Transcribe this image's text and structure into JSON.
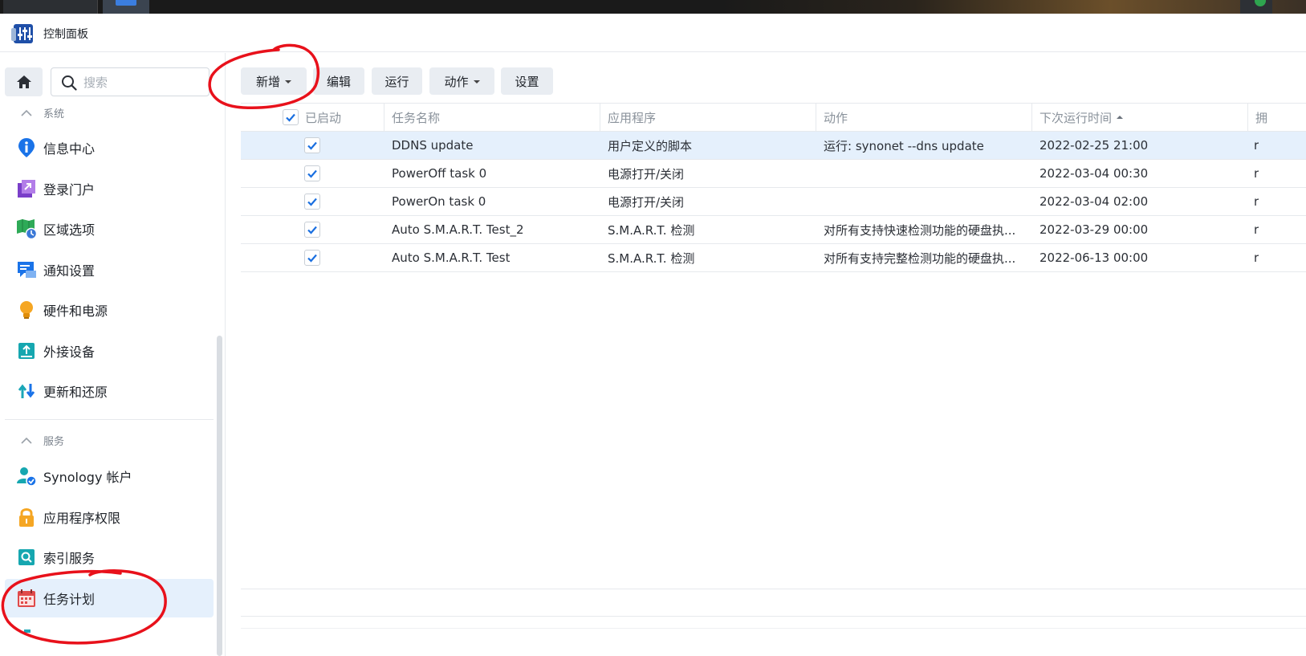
{
  "window": {
    "title": "控制面板"
  },
  "sidebar": {
    "search_placeholder": "搜索",
    "sections": [
      {
        "label": "系统"
      },
      {
        "label": "服务"
      }
    ],
    "items": [
      {
        "label": "信息中心",
        "icon": "info-icon"
      },
      {
        "label": "登录门户",
        "icon": "login-portal-icon"
      },
      {
        "label": "区域选项",
        "icon": "regional-options-icon"
      },
      {
        "label": "通知设置",
        "icon": "notification-icon"
      },
      {
        "label": "硬件和电源",
        "icon": "lightbulb-icon"
      },
      {
        "label": "外接设备",
        "icon": "external-device-icon"
      },
      {
        "label": "更新和还原",
        "icon": "update-restore-icon"
      },
      {
        "label": "Synology 帐户",
        "icon": "synology-account-icon"
      },
      {
        "label": "应用程序权限",
        "icon": "lock-icon"
      },
      {
        "label": "索引服务",
        "icon": "index-service-icon"
      },
      {
        "label": "任务计划",
        "icon": "calendar-icon",
        "active": true
      }
    ]
  },
  "toolbar": {
    "create": "新增",
    "edit": "编辑",
    "run": "运行",
    "action": "动作",
    "settings": "设置"
  },
  "table": {
    "columns": [
      "已启动",
      "任务名称",
      "应用程序",
      "动作",
      "下次运行时间",
      "拥"
    ],
    "sort_column": "下次运行时间",
    "sort_direction": "ascending",
    "rows": [
      {
        "enabled": true,
        "name": "DDNS update",
        "app": "用户定义的脚本",
        "action": "运行: synonet --dns update",
        "next_run": "2022-02-25 21:00",
        "owner": "r",
        "selected": true
      },
      {
        "enabled": true,
        "name": "PowerOff task 0",
        "app": "电源打开/关闭",
        "action": "",
        "next_run": "2022-03-04 00:30",
        "owner": "r"
      },
      {
        "enabled": true,
        "name": "PowerOn task 0",
        "app": "电源打开/关闭",
        "action": "",
        "next_run": "2022-03-04 02:00",
        "owner": "r"
      },
      {
        "enabled": true,
        "name": "Auto S.M.A.R.T. Test_2",
        "app": "S.M.A.R.T. 检测",
        "action": "对所有支持快速检测功能的硬盘执...",
        "next_run": "2022-03-29 00:00",
        "owner": "r"
      },
      {
        "enabled": true,
        "name": "Auto S.M.A.R.T. Test",
        "app": "S.M.A.R.T. 检测",
        "action": "对所有支持完整检测功能的硬盘执...",
        "next_run": "2022-06-13 00:00",
        "owner": "r"
      }
    ]
  },
  "colors": {
    "accent": "#1a6fe0",
    "selected_row": "#e5f0fc",
    "annotation_red": "#e8111b"
  }
}
